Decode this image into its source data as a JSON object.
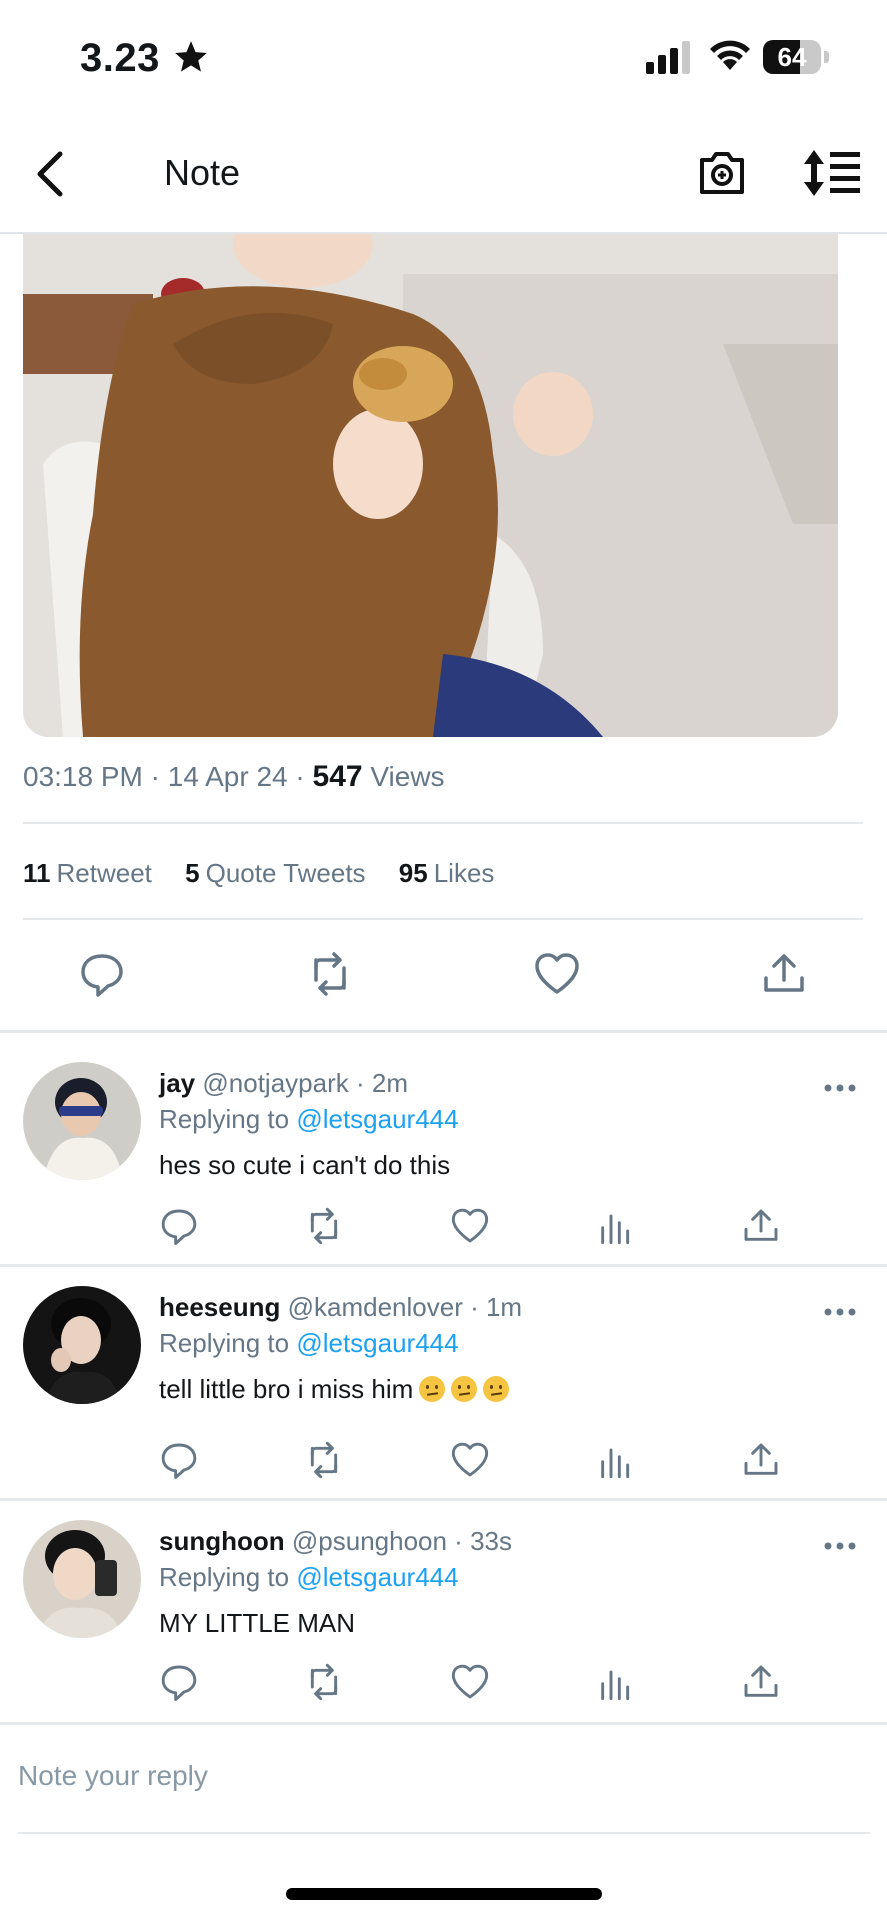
{
  "status_bar": {
    "time": "3.23",
    "battery_level": "64",
    "battery_fraction": 0.64
  },
  "header": {
    "title": "Note"
  },
  "tweet": {
    "time": "03:18 PM",
    "date": "14 Apr 24",
    "views_count": "547",
    "views_label": "Views",
    "retweets_count": "11",
    "retweets_label": "Retweet",
    "quotes_count": "5",
    "quotes_label": "Quote Tweets",
    "likes_count": "95",
    "likes_label": "Likes"
  },
  "replies": [
    {
      "name": "jay",
      "handle": "@notjaypark",
      "time": "2m",
      "replying_prefix": "Replying to",
      "replying_to": "@letsgaur444",
      "text": "hes so cute i can't do this"
    },
    {
      "name": "heeseung",
      "handle": "@kamdenlover",
      "time": "1m",
      "replying_prefix": "Replying to",
      "replying_to": "@letsgaur444",
      "text": "tell little bro i miss him"
    },
    {
      "name": "sunghoon",
      "handle": "@psunghoon",
      "time": "33s",
      "replying_prefix": "Replying to",
      "replying_to": "@letsgaur444",
      "text": "MY LITTLE MAN"
    }
  ],
  "composer": {
    "placeholder": "Note your reply"
  },
  "colors": {
    "link": "#1da1f2",
    "secondary_text": "#657786",
    "primary_text": "#14171a"
  }
}
